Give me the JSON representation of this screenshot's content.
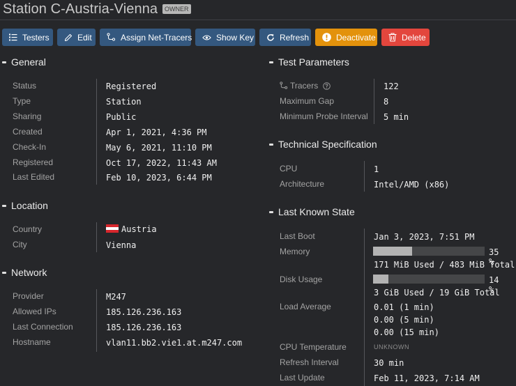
{
  "header": {
    "title": "Station C-Austria-Vienna",
    "badge": "OWNER"
  },
  "toolbar": {
    "buttons": [
      {
        "label": "Testers",
        "icon": "list-icon",
        "color": "#34587f"
      },
      {
        "label": "Edit",
        "icon": "pencil-icon",
        "color": "#34587f"
      },
      {
        "label": "Assign Net-Tracers",
        "icon": "route-icon",
        "color": "#34587f"
      },
      {
        "label": "Show Key",
        "icon": "eye-icon",
        "color": "#34587f"
      },
      {
        "label": "Refresh",
        "icon": "refresh-icon",
        "color": "#34587f"
      },
      {
        "label": "Deactivate",
        "icon": "exclamation-circle-icon",
        "color": "#e3920c"
      },
      {
        "label": "Delete",
        "icon": "trash-icon",
        "color": "#e3463d"
      }
    ]
  },
  "general": {
    "title": "General",
    "rows": [
      {
        "label": "Status",
        "value": "Registered"
      },
      {
        "label": "Type",
        "value": "Station"
      },
      {
        "label": "Sharing",
        "value": "Public"
      },
      {
        "label": "Created",
        "value": "Apr 1, 2021, 4:36 PM"
      },
      {
        "label": "Check-In",
        "value": "May 6, 2021, 11:10 PM"
      },
      {
        "label": "Registered",
        "value": "Oct 17, 2022, 11:43 AM"
      },
      {
        "label": "Last Edited",
        "value": "Feb 10, 2023, 6:44 PM"
      }
    ]
  },
  "location": {
    "title": "Location",
    "rows": [
      {
        "label": "Country",
        "value": "Austria",
        "flag": "austria-flag"
      },
      {
        "label": "City",
        "value": "Vienna"
      }
    ]
  },
  "network": {
    "title": "Network",
    "rows": [
      {
        "label": "Provider",
        "value": "M247"
      },
      {
        "label": "Allowed IPs",
        "value": "185.126.236.163"
      },
      {
        "label": "Last Connection",
        "value": "185.126.236.163"
      },
      {
        "label": "Hostname",
        "value": "vlan11.bb2.vie1.at.m247.com"
      }
    ]
  },
  "test_parameters": {
    "title": "Test Parameters",
    "rows": [
      {
        "label": "Tracers",
        "value": "122",
        "icon": "route-icon",
        "help": "help-circle-icon"
      },
      {
        "label": "Maximum Gap",
        "value": "8"
      },
      {
        "label": "Minimum Probe Interval",
        "value": "5 min"
      }
    ]
  },
  "technical_specification": {
    "title": "Technical Specification",
    "rows": [
      {
        "label": "CPU",
        "value": "1"
      },
      {
        "label": "Architecture",
        "value": "Intel/AMD (x86)"
      }
    ]
  },
  "last_known_state": {
    "title": "Last Known State",
    "last_boot": {
      "label": "Last Boot",
      "value": "Jan 3, 2023, 7:51 PM"
    },
    "memory": {
      "label": "Memory",
      "percent": 35,
      "percent_text": "35 %",
      "detail": "171 MiB Used / 483 MiB Total"
    },
    "disk": {
      "label": "Disk Usage",
      "percent": 14,
      "percent_text": "14 %",
      "detail": "3 GiB Used / 19 GiB Total"
    },
    "load_average": {
      "label": "Load Average",
      "values": [
        "0.01 (1 min)",
        "0.00 (5 min)",
        "0.00 (15 min)"
      ]
    },
    "cpu_temperature": {
      "label": "CPU Temperature",
      "value": "Unknown"
    },
    "refresh_interval": {
      "label": "Refresh Interval",
      "value": "30 min"
    },
    "last_update": {
      "label": "Last Update",
      "value": "Feb 11, 2023, 7:14 AM"
    }
  }
}
